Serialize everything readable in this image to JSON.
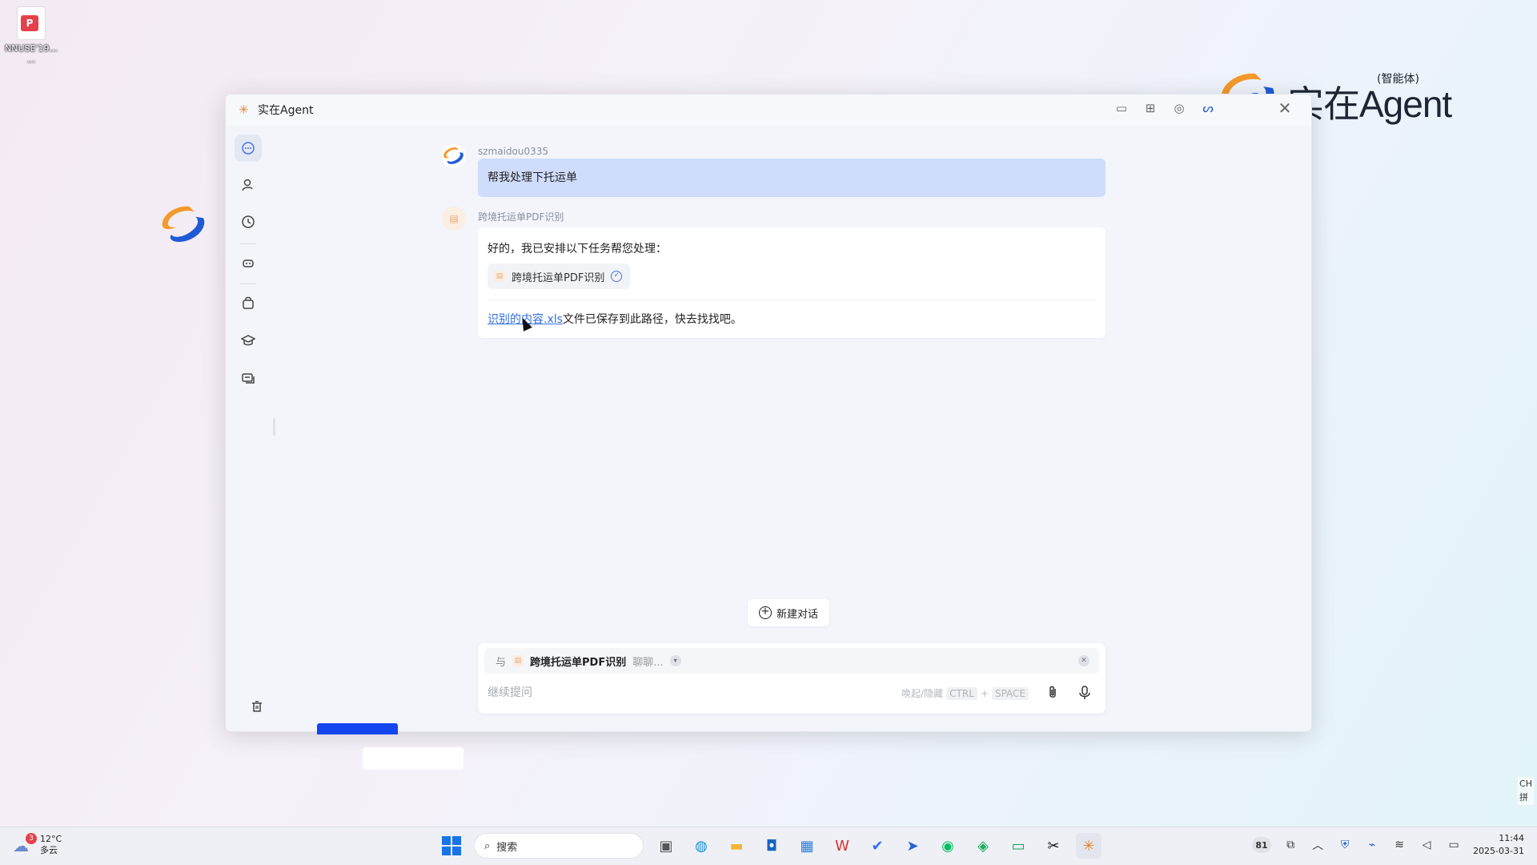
{
  "desktop": {
    "file_label": "NNUSE'19...\n..."
  },
  "brand": {
    "name": "实在Agent",
    "sub": "(智能体)"
  },
  "window": {
    "title": "实在Agent"
  },
  "chat": {
    "user_name": "szmaidou0335",
    "user_message": "帮我处理下托运单",
    "agent_name": "跨境托运单PDF识别",
    "agent_intro": "好的，我已安排以下任务帮您处理：",
    "task_label": "跨境托运单PDF识别",
    "file_link": "识别的内容.xls",
    "file_saved_text": "文件已保存到此路径，快去找找吧。"
  },
  "new_chat_label": "新建对话",
  "composer": {
    "with_label": "与",
    "agent_name": "跨境托运单PDF识别",
    "chat_label": "聊聊...",
    "placeholder": "继续提问",
    "hint_text": "唤起/隐藏",
    "key_ctrl": "CTRL",
    "plus": "+",
    "key_space": "SPACE"
  },
  "taskbar": {
    "weather_temp": "12°C",
    "weather_desc": "多云",
    "weather_badge": "3",
    "search_placeholder": "搜索",
    "battery_badge": "81",
    "time": "11:44",
    "date": "2025-03-31",
    "ime_lang": "CH",
    "ime_mode": "拼"
  }
}
